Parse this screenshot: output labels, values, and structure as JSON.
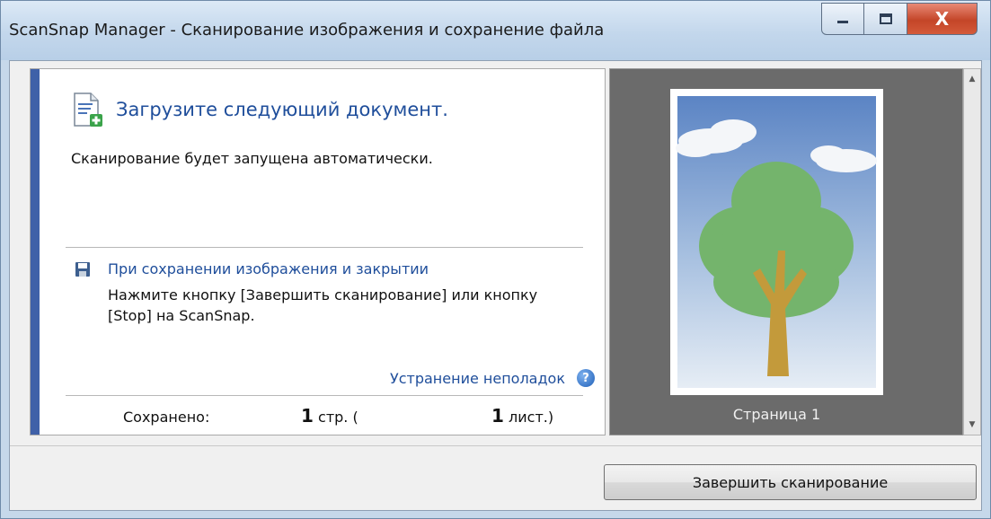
{
  "window": {
    "title": "ScanSnap Manager - Сканирование изображения и сохранение файла",
    "minimize_icon": "minimize-icon",
    "maximize_icon": "maximize-icon",
    "close_icon": "close-icon",
    "close_glyph": "X"
  },
  "status": {
    "heading": "Загрузите следующий документ.",
    "message": "Сканирование будет запущена автоматически."
  },
  "save_info": {
    "heading": "При сохранении изображения и закрытии",
    "text": "Нажмите кнопку [Завершить сканирование] или кнопку [Stop] на ScanSnap."
  },
  "troubleshooting": {
    "label": "Устранение неполадок",
    "icon_glyph": "?"
  },
  "saved": {
    "label": "Сохранено:",
    "pages_count": "1",
    "pages_unit": "стр. (",
    "sheets_count": "1",
    "sheets_unit": "лист.)"
  },
  "preview": {
    "page_label": "Страница 1"
  },
  "actions": {
    "finish_label": "Завершить сканирование"
  },
  "colors": {
    "accent": "#3f61a8",
    "link": "#1f4e9b",
    "close_button": "#c44528"
  }
}
